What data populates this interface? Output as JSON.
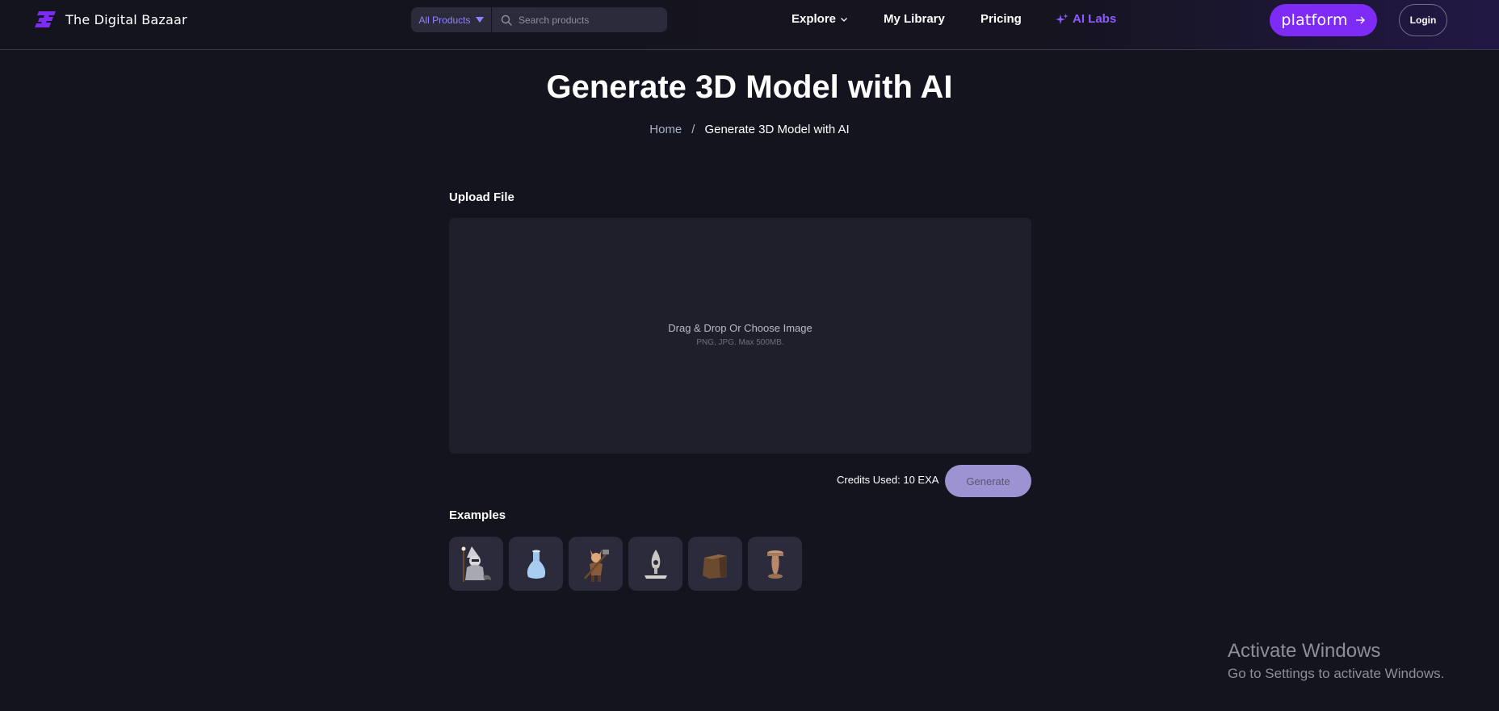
{
  "brand": {
    "name": "The Digital Bazaar",
    "accent": "#7d2bf5",
    "link_accent": "#8c5cff"
  },
  "search": {
    "category": "All Products",
    "placeholder": "Search products"
  },
  "nav": {
    "explore": "Explore",
    "library": "My Library",
    "pricing": "Pricing",
    "ai_labs": "AI Labs"
  },
  "platform_button": {
    "label": "platform"
  },
  "login_button": {
    "label": "Login"
  },
  "page": {
    "title": "Generate 3D Model with AI",
    "breadcrumb": {
      "home": "Home",
      "separator": "/",
      "current": "Generate 3D Model with AI"
    }
  },
  "upload": {
    "label": "Upload File",
    "dropzone_text": "Drag & Drop Or Choose Image",
    "dropzone_hint": "PNG, JPG. Max 500MB."
  },
  "credits": "Credits Used: 10 EXA",
  "generate_button": {
    "label": "Generate"
  },
  "examples": {
    "label": "Examples",
    "items": [
      {
        "icon": "raccoon-wizard-thumbnail"
      },
      {
        "icon": "glass-vase-thumbnail"
      },
      {
        "icon": "fox-warrior-thumbnail"
      },
      {
        "icon": "stone-sculpture-thumbnail"
      },
      {
        "icon": "wooden-stump-thumbnail"
      },
      {
        "icon": "wooden-pedestal-thumbnail"
      }
    ]
  },
  "windows_watermark": {
    "title": "Activate Windows",
    "subtitle": "Go to Settings to activate Windows."
  }
}
